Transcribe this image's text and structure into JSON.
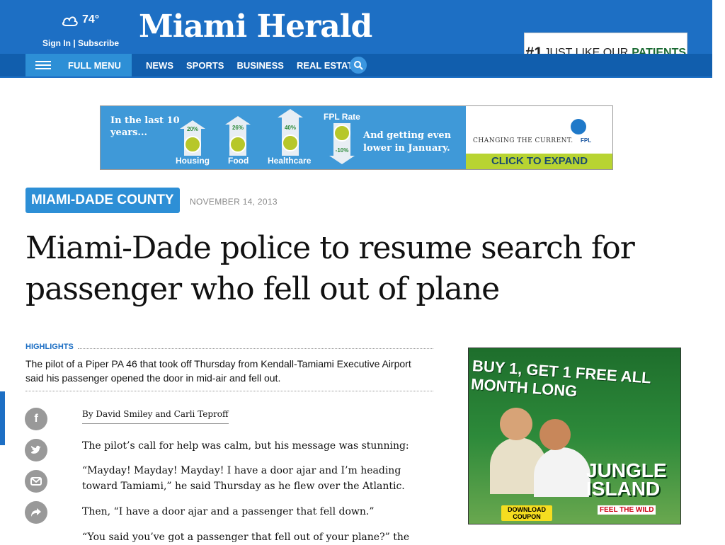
{
  "header": {
    "temperature": "74°",
    "signin": "Sign In | Subscribe",
    "logo": "Miami Herald",
    "menu_label": "FULL MENU",
    "nav": [
      "NEWS",
      "SPORTS",
      "BUSINESS",
      "REAL ESTATE"
    ],
    "promo": {
      "num": "#1",
      "text": "JUST LIKE OUR",
      "bold": "PATIENTS"
    }
  },
  "banner_ad": {
    "intro": "In the last 10 years...",
    "arrows": [
      {
        "pct": "20%",
        "label": "Housing"
      },
      {
        "pct": "26%",
        "label": "Food"
      },
      {
        "pct": "40%",
        "label": "Healthcare"
      }
    ],
    "fpl_rate": "FPL Rate",
    "fpl_pct": "-10%",
    "tagline": "And getting even lower in January.",
    "changing": "CHANGING THE CURRENT.",
    "fpl": "FPL",
    "expand": "CLICK TO EXPAND"
  },
  "article": {
    "section": "MIAMI-DADE COUNTY",
    "date": "NOVEMBER 14, 2013",
    "headline": "Miami-Dade police to resume search for passenger who fell out of plane",
    "highlights_label": "HIGHLIGHTS",
    "highlights": "The pilot of a Piper PA 46 that took off Thursday from Kendall-Tamiami Executive Airport said his passenger opened the door in mid-air and fell out.",
    "byline": "By David Smiley and Carli Teproff",
    "paragraphs": [
      "The pilot’s call for help was calm, but his message was stunning:",
      "“Mayday! Mayday! Mayday! I have a door ajar and I’m heading toward Tamiami,” he said Thursday as he flew over the Atlantic.",
      "Then, “I have a door ajar and a passenger that fell down.”",
      "“You said you’ve got a passenger that fell out of your plane?” the"
    ]
  },
  "side_ad": {
    "headline": "BUY 1, GET 1 FREE ALL MONTH LONG",
    "brand_line1": "JUNGLE",
    "brand_line2": "ISLAND",
    "tagline": "FEEL THE WILD",
    "download": "DOWNLOAD COUPON"
  },
  "colors": {
    "brand_blue": "#1d6fc4",
    "nav_blue": "#115ead",
    "accent_blue": "#2d8fd6",
    "ad_green": "#b8d432"
  }
}
